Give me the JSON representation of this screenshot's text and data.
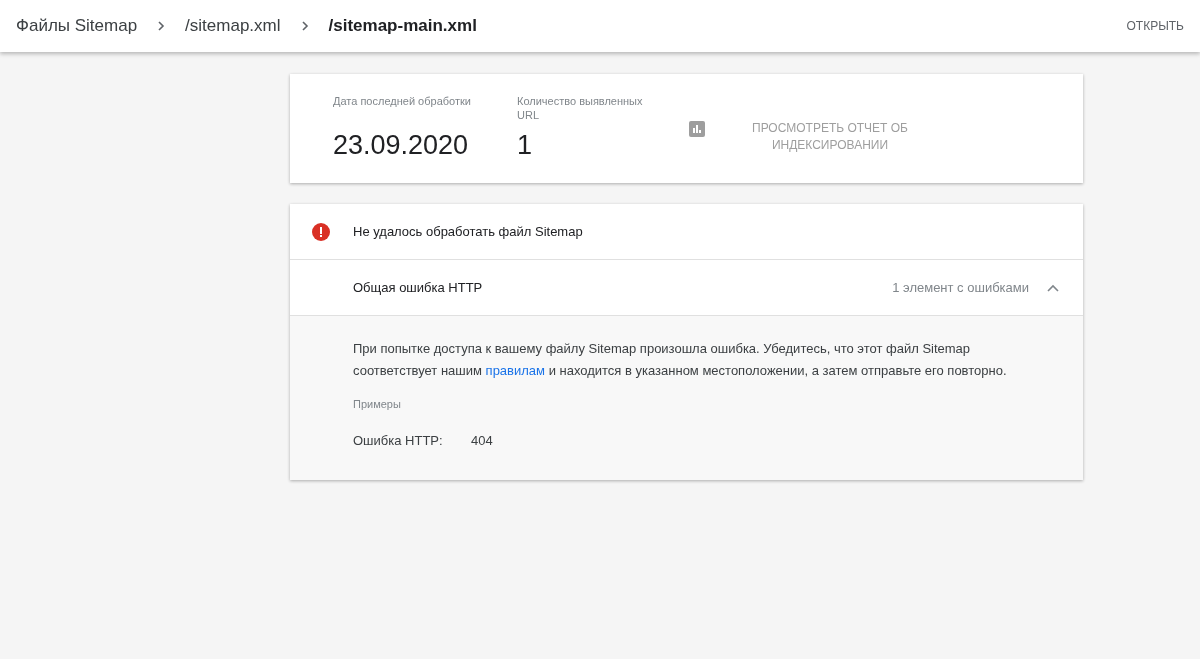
{
  "breadcrumbs": [
    {
      "label": "Файлы Sitemap",
      "current": false
    },
    {
      "label": "/sitemap.xml",
      "current": false
    },
    {
      "label": "/sitemap-main.xml",
      "current": true
    }
  ],
  "open_button": "ОТКРЫТЬ",
  "summary": {
    "stats": [
      {
        "label": "Дата последней обработки",
        "value": "23.09.2020"
      },
      {
        "label": "Количество выявленных URL",
        "value": "1"
      }
    ],
    "report_link": "ПРОСМОТРЕТЬ ОТЧЕТ ОБ ИНДЕКСИРОВАНИИ"
  },
  "status": {
    "message": "Не удалось обработать файл Sitemap"
  },
  "error": {
    "title": "Общая ошибка HTTP",
    "count": "1 элемент с ошибками",
    "expanded": true,
    "description": {
      "before": "При попытке доступа к вашему файлу Sitemap произошла ошибка. Убедитесь, что этот файл Sitemap соответствует нашим",
      "link": "правилам",
      "after": "и находится в указанном местоположении, а затем отправьте его повторно."
    },
    "examples_label": "Примеры",
    "examples": [
      {
        "label": "Ошибка HTTP:",
        "value": "404"
      }
    ]
  }
}
